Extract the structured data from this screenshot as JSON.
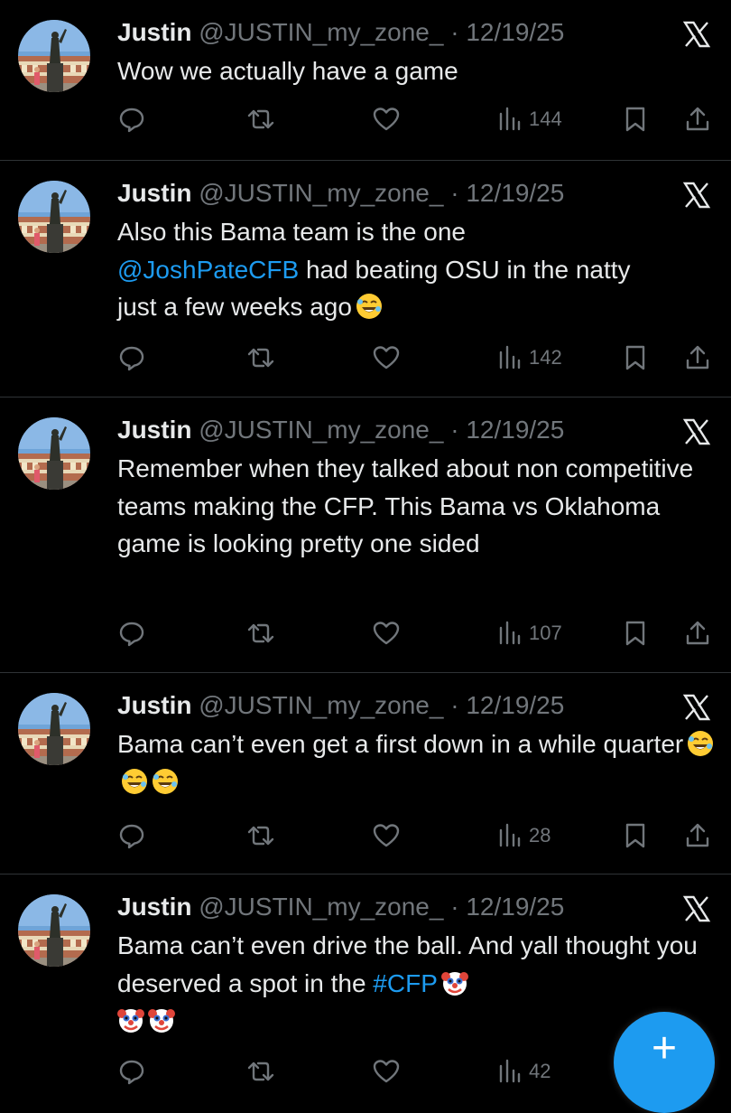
{
  "colors": {
    "background": "#000000",
    "text": "#e7e9ea",
    "muted": "#71767b",
    "link": "#1d9bf0",
    "divider": "#2f3336",
    "fab": "#1d9bf0"
  },
  "icons": {
    "reply": "comment-bubble-icon",
    "retweet": "retweet-icon",
    "like": "heart-icon",
    "views": "bar-chart-icon",
    "bookmark": "bookmark-icon",
    "share": "share-icon",
    "close": "x-logo-icon",
    "emoji": "rofl-emoji / clown-emoji",
    "fab": "plus-icon"
  },
  "tweets": [
    {
      "name": "Justin",
      "handle": "@JUSTIN_my_zone_",
      "separator": " · ",
      "date": "12/19/25",
      "text": "Wow we actually have a game",
      "views": "144"
    },
    {
      "name": "Justin",
      "handle": "@JUSTIN_my_zone_",
      "separator": " · ",
      "date": "12/19/25",
      "text_line1": "Also this Bama team is the one",
      "mention": "@JoshPateCFB",
      "text_line2": " had beating OSU in the natty",
      "text_line3": "just a few weeks ago",
      "emoji_1": "rofl",
      "views": "142"
    },
    {
      "name": "Justin",
      "handle": "@JUSTIN_my_zone_",
      "separator": " · ",
      "date": "12/19/25",
      "text": "Remember when they talked about non competitive teams making the CFP. This Bama vs Oklahoma game is looking pretty one sided",
      "views": "107"
    },
    {
      "name": "Justin",
      "handle": "@JUSTIN_my_zone_",
      "separator": " · ",
      "date": "12/19/25",
      "text": "Bama can’t even get a first down in a while quarter",
      "emoji": [
        "rofl",
        "rofl",
        "rofl"
      ],
      "views": "28"
    },
    {
      "name": "Justin",
      "handle": "@JUSTIN_my_zone_",
      "separator": " · ",
      "date": "12/19/25",
      "text_part1": "Bama can’t even drive the ball. And yall thought you deserved a spot in the ",
      "hashtag": "#CFP",
      "emoji": [
        "clown",
        "clown",
        "clown"
      ],
      "views": "42"
    }
  ],
  "fab": {
    "label": "+"
  }
}
